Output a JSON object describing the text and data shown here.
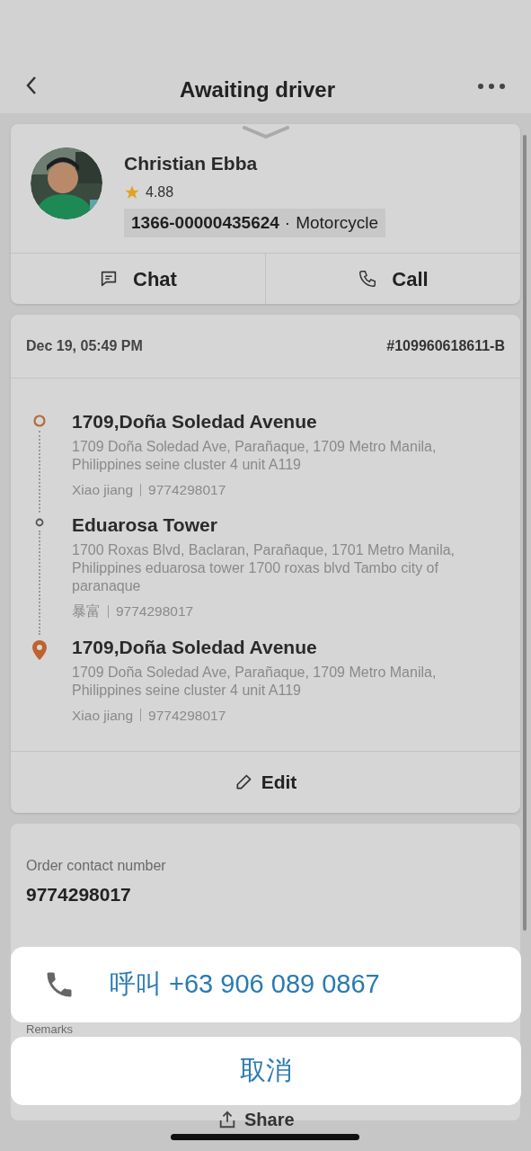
{
  "header": {
    "title": "Awaiting driver"
  },
  "driver": {
    "name": "Christian Ebba",
    "rating": "4.88",
    "plate": "1366-00000435624",
    "vehicle": "Motorcycle",
    "separator": "·"
  },
  "driver_actions": [
    {
      "kind": "chat",
      "label": "Chat"
    },
    {
      "kind": "call",
      "label": "Call"
    }
  ],
  "order": {
    "time": "Dec 19, 05:49 PM",
    "number": "#109960618611-B",
    "stops": [
      {
        "kind": "pickup",
        "title": "1709,Doña Soledad Avenue",
        "address": "1709 Doña Soledad Ave, Parañaque, 1709 Metro Manila, Philippines seine cluster 4 unit A119",
        "contact": "Xiao jiang",
        "phone": "9774298017"
      },
      {
        "kind": "stop",
        "title": "Eduarosa Tower",
        "address": "1700 Roxas Blvd, Baclaran, Parañaque, 1701 Metro Manila, Philippines eduarosa tower 1700 roxas blvd Tambo city of paranaque",
        "contact": "暴富",
        "phone": "9774298017"
      },
      {
        "kind": "dropoff",
        "title": "1709,Doña Soledad Avenue",
        "address": "1709 Doña Soledad Ave, Parañaque, 1709 Metro Manila, Philippines seine cluster 4 unit A119",
        "contact": "Xiao jiang",
        "phone": "9774298017"
      }
    ],
    "edit_label": "Edit"
  },
  "contact": {
    "label": "Order contact number",
    "value": "9774298017",
    "remarks_label": "Remarks"
  },
  "share_label": "Share",
  "action_sheet": {
    "call_label": "呼叫 +63 906 089 0867",
    "cancel_label": "取消"
  }
}
